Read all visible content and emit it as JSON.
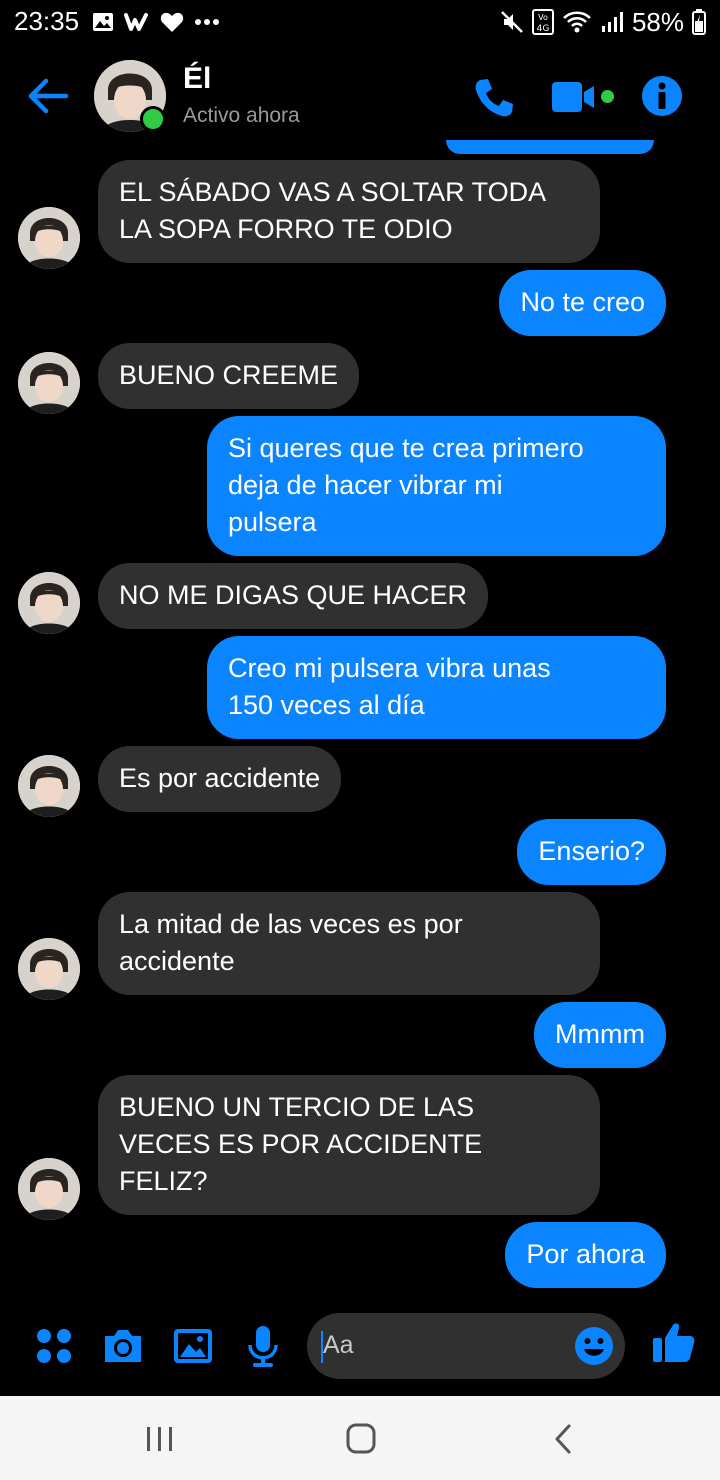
{
  "status_bar": {
    "time": "23:35",
    "left_icons": [
      "gallery-icon",
      "wattpad-icon",
      "heart-icon",
      "more-dots-icon"
    ],
    "right_icons": [
      "mute-icon",
      "volte-4g-icon",
      "wifi-icon",
      "signal-icon"
    ],
    "battery": "58%"
  },
  "header": {
    "name": "Él",
    "status": "Activo ahora",
    "accent": "#0b84ff",
    "online_color": "#31cc46"
  },
  "messages": [
    {
      "from": "them",
      "text": "EL SÁBADO VAS A SOLTAR TODA\nLA SOPA FORRO TE ODIO"
    },
    {
      "from": "me",
      "text": "No te creo"
    },
    {
      "from": "them",
      "text": "BUENO CREEME"
    },
    {
      "from": "me",
      "text": "Si queres que te crea primero\ndeja de hacer vibrar mi\npulsera"
    },
    {
      "from": "them",
      "text": "NO ME DIGAS QUE HACER"
    },
    {
      "from": "me",
      "text": "Creo mi pulsera vibra unas\n150 veces al día"
    },
    {
      "from": "them",
      "text": "Es por accidente"
    },
    {
      "from": "me",
      "text": "Enserio?"
    },
    {
      "from": "them",
      "text": "La mitad de las veces es por\naccidente"
    },
    {
      "from": "me",
      "text": "Mmmm"
    },
    {
      "from": "them",
      "text": "BUENO UN TERCIO DE LAS\nVECES ES POR ACCIDENTE\nFELIZ?"
    },
    {
      "from": "me",
      "text": "Por ahora"
    }
  ],
  "composer": {
    "placeholder": "Aa",
    "buttons": [
      "apps-icon",
      "camera-icon",
      "gallery-icon",
      "microphone-icon",
      "emoji-icon",
      "like-icon"
    ]
  },
  "nav_bar": {
    "buttons": [
      "recent-apps-icon",
      "home-icon",
      "back-icon"
    ]
  }
}
